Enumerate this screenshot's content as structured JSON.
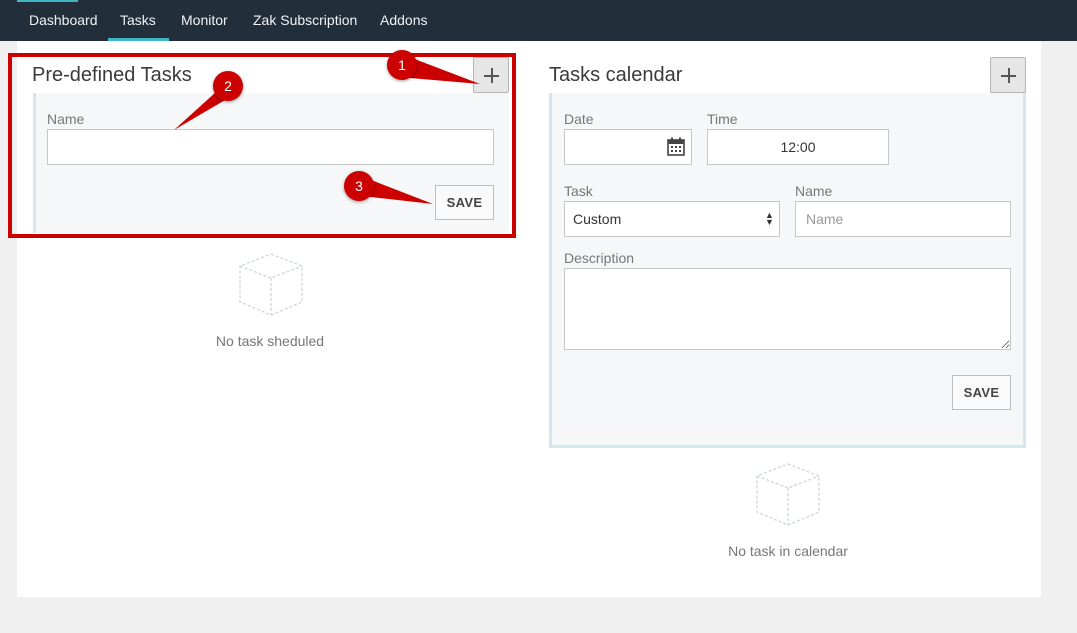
{
  "nav": {
    "items": [
      "Dashboard",
      "Tasks",
      "Monitor",
      "Zak Subscription",
      "Addons"
    ],
    "active": "Tasks"
  },
  "predefined": {
    "title": "Pre-defined Tasks",
    "name_label": "Name",
    "name_value": "",
    "save_label": "SAVE",
    "empty_text": "No task sheduled"
  },
  "calendar": {
    "title": "Tasks calendar",
    "date_label": "Date",
    "date_value": "",
    "time_label": "Time",
    "time_value": "12:00",
    "task_label": "Task",
    "task_selected": "Custom",
    "name_label": "Name",
    "name_placeholder": "Name",
    "description_label": "Description",
    "description_value": "",
    "save_label": "SAVE",
    "empty_text": "No task in calendar"
  },
  "annotations": {
    "markers": [
      "1",
      "2",
      "3"
    ],
    "color": "#cc0000"
  },
  "colors": {
    "nav_bg": "#232e3b",
    "accent": "#3fb6c3",
    "panel_bg": "#f5f7f8"
  }
}
